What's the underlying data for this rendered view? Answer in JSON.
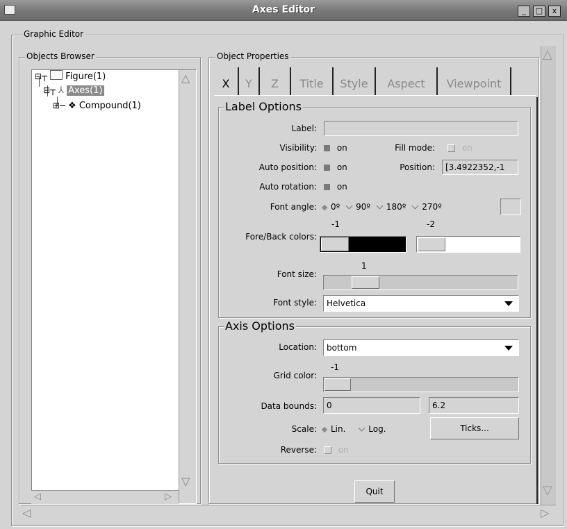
{
  "window": {
    "title": "Axes Editor",
    "buttons": {
      "minimize": "_",
      "maximize": "□",
      "close": "x"
    }
  },
  "graphic_editor": {
    "legend": "Graphic Editor"
  },
  "objects_browser": {
    "legend": "Objects Browser",
    "tree": [
      {
        "label": "Figure(1)",
        "icon": "figure-icon",
        "expanded": true,
        "selected": false
      },
      {
        "label": "Axes(1)",
        "icon": "axes-icon",
        "expanded": true,
        "selected": true
      },
      {
        "label": "Compound(1)",
        "icon": "compound-icon",
        "expanded": false,
        "selected": false
      }
    ]
  },
  "object_properties": {
    "legend": "Object Properties",
    "tabs": [
      "X",
      "Y",
      "Z",
      "Title",
      "Style",
      "Aspect",
      "Viewpoint"
    ],
    "active_tab": "X"
  },
  "label_options": {
    "legend": "Label Options",
    "label": {
      "label": "Label:",
      "value": ""
    },
    "visibility": {
      "label": "Visibility:",
      "state": "on",
      "checked": true
    },
    "fill_mode": {
      "label": "Fill mode:",
      "state": "on",
      "checked": false
    },
    "auto_position": {
      "label": "Auto position:",
      "state": "on",
      "checked": true
    },
    "position": {
      "label": "Position:",
      "value": "[3.4922352,-1"
    },
    "auto_rotation": {
      "label": "Auto rotation:",
      "state": "on",
      "checked": true
    },
    "font_angle": {
      "label": "Font angle:",
      "options": [
        "0º",
        "90º",
        "180º",
        "270º"
      ],
      "selected": "0º",
      "custom_value": ""
    },
    "fore_back": {
      "label": "Fore/Back colors:",
      "fore_value": "-1",
      "back_value": "-2",
      "fore_color": "#000000",
      "back_color": "#ffffff"
    },
    "font_size": {
      "label": "Font size:",
      "value": "1"
    },
    "font_style": {
      "label": "Font style:",
      "value": "Helvetica"
    }
  },
  "axis_options": {
    "legend": "Axis Options",
    "location": {
      "label": "Location:",
      "value": "bottom"
    },
    "grid_color": {
      "label": "Grid color:",
      "value": "-1"
    },
    "data_bounds": {
      "label": "Data bounds:",
      "min": "0",
      "max": "6.2"
    },
    "scale": {
      "label": "Scale:",
      "options": [
        "Lin.",
        "Log."
      ],
      "selected": "Lin.",
      "ticks_button": "Ticks..."
    },
    "reverse": {
      "label": "Reverse:",
      "state": "on",
      "checked": false
    }
  },
  "footer": {
    "quit_button": "Quit"
  }
}
